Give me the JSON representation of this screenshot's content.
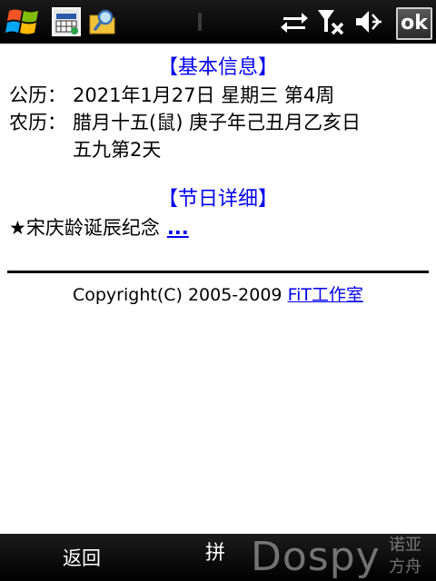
{
  "status_bar": {
    "ok_label": "ok",
    "icons": [
      "windows-start-icon",
      "calendar-app-icon",
      "search-folder-icon",
      "text-cursor-icon",
      "sync-arrows-icon",
      "no-signal-icon",
      "volume-muted-icon"
    ]
  },
  "basic_info": {
    "title": "【基本信息】",
    "solar_label": "公历：",
    "solar_value": "2021年1月27日 星期三 第4周",
    "lunar_label": "农历：",
    "lunar_value_line1": "腊月十五(鼠) 庚子年己丑月乙亥日",
    "lunar_value_line2": "五九第2天"
  },
  "festival_details": {
    "title": "【节日详细】",
    "item": "★宋庆龄诞辰纪念",
    "more_link": "..."
  },
  "footer": {
    "copyright_text": "Copyright(C) 2005-2009 ",
    "copyright_link": "FiT工作室"
  },
  "bottom_bar": {
    "back_label": "返回",
    "input_method_label": "拼",
    "watermark_main": "Dospy",
    "watermark_sub1": "诺亚",
    "watermark_sub2": "方舟"
  },
  "colors": {
    "link": "#0000ee",
    "bar_background": "#000000",
    "text": "#000000"
  }
}
